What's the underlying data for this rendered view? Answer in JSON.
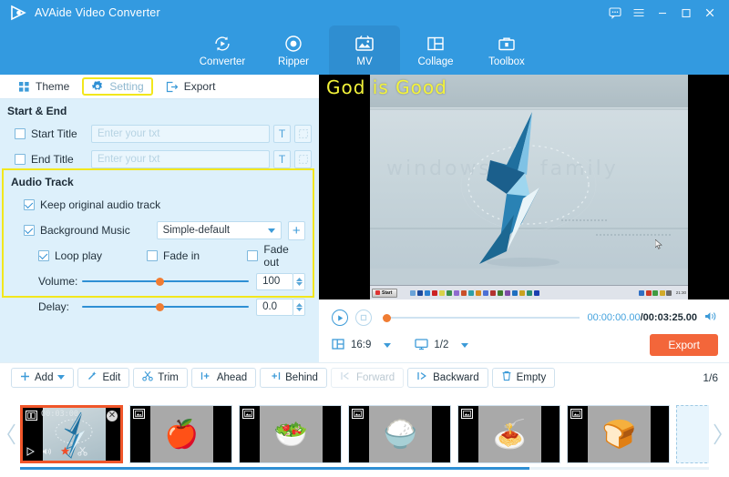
{
  "titlebar": {
    "app_title": "AVAide Video Converter",
    "logo_icon": "play-triangle-logo",
    "buttons": [
      {
        "name": "feedback-icon",
        "label": "⌨"
      },
      {
        "name": "menu-icon",
        "label": "☰"
      },
      {
        "name": "minimize-icon",
        "label": "–"
      },
      {
        "name": "maximize-icon",
        "label": "□"
      },
      {
        "name": "close-icon",
        "label": "✕"
      }
    ]
  },
  "nav": {
    "items": [
      {
        "label": "Converter",
        "icon": "convert-arrows-icon",
        "active": false
      },
      {
        "label": "Ripper",
        "icon": "disc-icon",
        "active": false
      },
      {
        "label": "MV",
        "icon": "picture-frame-icon",
        "active": true
      },
      {
        "label": "Collage",
        "icon": "grid-layout-icon",
        "active": false
      },
      {
        "label": "Toolbox",
        "icon": "toolbox-icon",
        "active": false
      }
    ]
  },
  "tabs": [
    {
      "label": "Theme",
      "icon": "grid-dots-icon",
      "highlight": false
    },
    {
      "label": "Setting",
      "icon": "gear-icon",
      "highlight": true
    },
    {
      "label": "Export",
      "icon": "export-arrow-icon",
      "highlight": false
    }
  ],
  "start_end": {
    "heading": "Start & End",
    "start_title": {
      "label": "Start Title",
      "checked": false,
      "value": "",
      "placeholder": "Enter your txt",
      "text_button": "T",
      "style_button": "style-grid-icon"
    },
    "end_title": {
      "label": "End Title",
      "checked": false,
      "value": "",
      "placeholder": "Enter your txt",
      "text_button": "T",
      "style_button": "style-grid-icon"
    }
  },
  "audio_track": {
    "heading": "Audio Track",
    "highlight_color": "#f2e71c",
    "keep_original": {
      "label": "Keep original audio track",
      "checked": true
    },
    "background_music": {
      "label": "Background Music",
      "checked": true
    },
    "music_select": {
      "value": "Simple-default",
      "caret": "▼"
    },
    "add_music_button": "+",
    "loop_play": {
      "label": "Loop play",
      "checked": true
    },
    "fade_in": {
      "label": "Fade in",
      "checked": false
    },
    "fade_out": {
      "label": "Fade out",
      "checked": false
    },
    "volume": {
      "label": "Volume:",
      "value": "100",
      "percent": 47
    },
    "delay": {
      "label": "Delay:",
      "value": "0.0",
      "percent": 47
    }
  },
  "preview": {
    "overlay_title": "God is Good",
    "taskbar_start": "Start",
    "taskbar_time": "21:30",
    "player": {
      "play_icon": "play-circle-icon",
      "stop_icon": "stop-square-icon",
      "seek_percent": 0,
      "current_time": "00:00:00.00",
      "separator": "/",
      "total_time": "00:03:25.00",
      "volume_icon": "speaker-icon",
      "aspect_icon": "aspect-ratio-icon",
      "aspect_value": "16:9",
      "screen_icon": "monitor-icon",
      "split_value": "1/2",
      "export_label": "Export"
    }
  },
  "toolstrip": {
    "buttons": [
      {
        "label": "Add",
        "icon": "plus-icon",
        "caret": true,
        "disabled": false
      },
      {
        "label": "Edit",
        "icon": "magic-wand-icon",
        "caret": false,
        "disabled": false
      },
      {
        "label": "Trim",
        "icon": "scissors-icon",
        "caret": false,
        "disabled": false
      },
      {
        "label": "Ahead",
        "icon": "insert-ahead-icon",
        "caret": false,
        "disabled": false
      },
      {
        "label": "Behind",
        "icon": "insert-behind-icon",
        "caret": false,
        "disabled": false
      },
      {
        "label": "Forward",
        "icon": "move-forward-icon",
        "caret": false,
        "disabled": true
      },
      {
        "label": "Backward",
        "icon": "move-backward-icon",
        "caret": false,
        "disabled": false
      },
      {
        "label": "Empty",
        "icon": "trash-icon",
        "caret": false,
        "disabled": false
      }
    ],
    "page_count": "1/6"
  },
  "filmstrip": {
    "prev_arrow": "‹",
    "next_arrow": "›",
    "scroll_percent": 74,
    "clips": [
      {
        "type": "video",
        "selected": true,
        "duration": "00:03:00",
        "badge_icon": "video-badge-icon",
        "close_icon": "remove-clip-icon",
        "tools": [
          "play-icon",
          "volume-icon",
          "effects-icon",
          "trim-icon"
        ]
      },
      {
        "type": "image",
        "selected": false,
        "emoji": "🍎",
        "badge_icon": "image-badge-icon"
      },
      {
        "type": "image",
        "selected": false,
        "emoji": "🥗",
        "badge_icon": "image-badge-icon"
      },
      {
        "type": "image",
        "selected": false,
        "emoji": "🍚",
        "badge_icon": "image-badge-icon"
      },
      {
        "type": "image",
        "selected": false,
        "emoji": "🍝",
        "badge_icon": "image-badge-icon"
      },
      {
        "type": "image",
        "selected": false,
        "emoji": "🍞",
        "badge_icon": "image-badge-icon"
      }
    ],
    "add_slot": "add-media-slot"
  },
  "colors": {
    "brand_blue": "#339ae0",
    "panel_blue": "#ddf0fb",
    "accent_orange": "#f3663a",
    "highlight_yellow": "#f2e71c",
    "slider_orange": "#f07c32"
  }
}
